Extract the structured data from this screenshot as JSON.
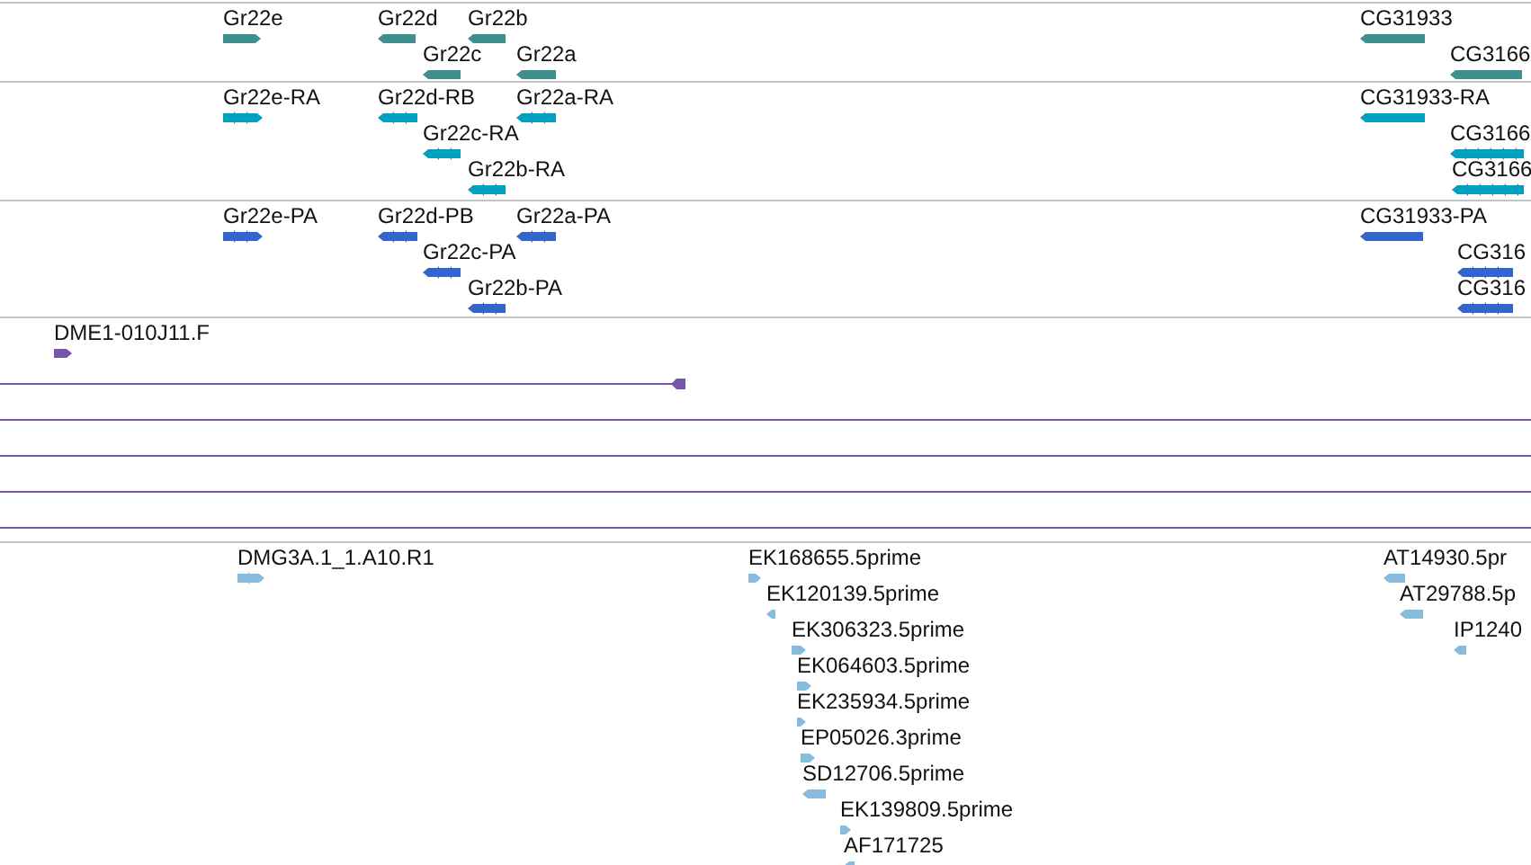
{
  "tracks": [
    {
      "color": "#3f8f8f",
      "features": [
        {
          "label": "Gr22e",
          "reverse": false,
          "kind": "gene"
        },
        {
          "label": "Gr22d",
          "reverse": true,
          "kind": "gene"
        },
        {
          "label": "Gr22b",
          "reverse": true,
          "kind": "gene"
        },
        {
          "label": "Gr22c",
          "reverse": true,
          "kind": "gene"
        },
        {
          "label": "Gr22a",
          "reverse": true,
          "kind": "gene"
        },
        {
          "label": "CG31933",
          "reverse": true,
          "kind": "gene"
        },
        {
          "label": "CG3166",
          "reverse": true,
          "kind": "gene"
        }
      ]
    },
    {
      "color": "#00a0c0",
      "features": [
        {
          "label": "Gr22e-RA",
          "reverse": false,
          "kind": "transcript"
        },
        {
          "label": "Gr22d-RB",
          "reverse": true,
          "kind": "transcript"
        },
        {
          "label": "Gr22a-RA",
          "reverse": true,
          "kind": "transcript"
        },
        {
          "label": "Gr22c-RA",
          "reverse": true,
          "kind": "transcript"
        },
        {
          "label": "Gr22b-RA",
          "reverse": true,
          "kind": "transcript"
        },
        {
          "label": "CG31933-RA",
          "reverse": true,
          "kind": "gene"
        },
        {
          "label": "CG3166",
          "reverse": true,
          "kind": "transcript"
        },
        {
          "label": "CG3166",
          "reverse": true,
          "kind": "transcript"
        }
      ]
    },
    {
      "color": "#3366cc",
      "features": [
        {
          "label": "Gr22e-PA",
          "reverse": false,
          "kind": "transcript"
        },
        {
          "label": "Gr22d-PB",
          "reverse": true,
          "kind": "transcript"
        },
        {
          "label": "Gr22a-PA",
          "reverse": true,
          "kind": "transcript"
        },
        {
          "label": "Gr22c-PA",
          "reverse": true,
          "kind": "transcript"
        },
        {
          "label": "Gr22b-PA",
          "reverse": true,
          "kind": "transcript"
        },
        {
          "label": "CG31933-PA",
          "reverse": true,
          "kind": "gene"
        },
        {
          "label": "CG316",
          "reverse": true,
          "kind": "transcript"
        },
        {
          "label": "CG316",
          "reverse": true,
          "kind": "transcript"
        }
      ]
    },
    {
      "color": "#7755aa",
      "features": [
        {
          "label": "DME1-010J11.F",
          "reverse": false,
          "kind": "gene"
        },
        {
          "arrowhead": true,
          "kind": "line"
        },
        {
          "arrowhead": false,
          "kind": "line"
        },
        {
          "arrowhead": false,
          "kind": "line"
        },
        {
          "arrowhead": false,
          "kind": "line"
        },
        {
          "arrowhead": false,
          "kind": "line"
        }
      ]
    },
    {
      "color": "#88bbdd",
      "features": [
        {
          "label": "DMG3A.1_1.A10.R1",
          "reverse": false,
          "kind": "transcript"
        },
        {
          "label": "EK168655.5prime",
          "reverse": false,
          "kind": "gene"
        },
        {
          "label": "EK120139.5prime",
          "reverse": true,
          "kind": "gene"
        },
        {
          "label": "EK306323.5prime",
          "reverse": false,
          "kind": "gene"
        },
        {
          "label": "EK064603.5prime",
          "reverse": false,
          "kind": "gene"
        },
        {
          "label": "EK235934.5prime",
          "reverse": false,
          "kind": "gene"
        },
        {
          "label": "EP05026.3prime",
          "reverse": false,
          "kind": "gene"
        },
        {
          "label": "SD12706.5prime",
          "reverse": true,
          "kind": "gene"
        },
        {
          "label": "EK139809.5prime",
          "reverse": false,
          "kind": "gene"
        },
        {
          "label": "AF171725",
          "reverse": true,
          "kind": "gene"
        },
        {
          "label": "AT14930.5pr",
          "reverse": true,
          "kind": "gene"
        },
        {
          "label": "AT29788.5p",
          "reverse": true,
          "kind": "gene"
        },
        {
          "label": "IP1240",
          "reverse": true,
          "kind": "gene"
        }
      ]
    }
  ]
}
